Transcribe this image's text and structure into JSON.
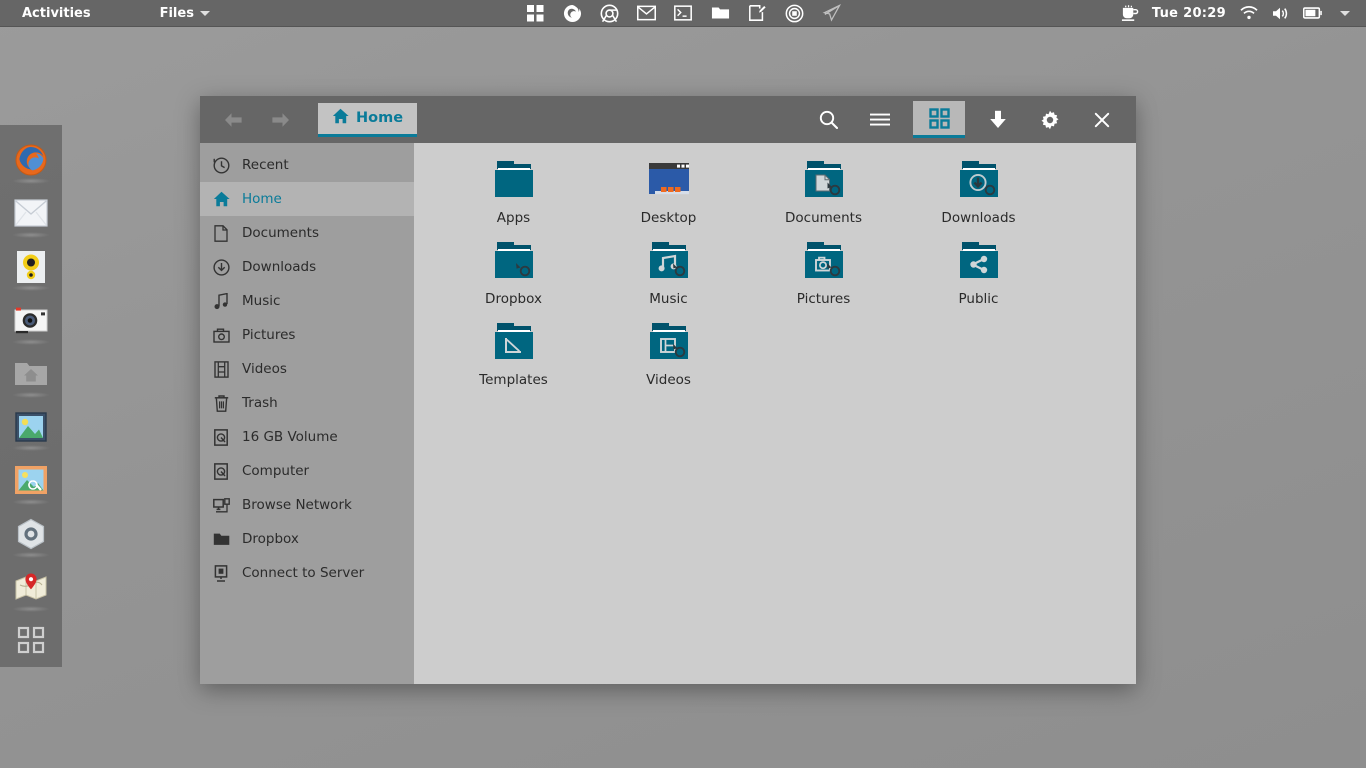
{
  "topbar": {
    "activities": "Activities",
    "app_menu": "Files",
    "app_menu_caret": "chevron-down-icon",
    "center_icons": [
      "apps-grid-icon",
      "firefox-icon",
      "chrome-icon",
      "mail-icon",
      "terminal-icon",
      "files-icon",
      "text-editor-icon",
      "media-disc-icon",
      "sketch-icon"
    ],
    "coffee_icon": "coffee-cup-icon",
    "clock": "Tue 20:29",
    "right_icons": [
      "wifi-icon",
      "volume-icon",
      "battery-icon",
      "chevron-down-icon"
    ]
  },
  "dock": {
    "items": [
      {
        "name": "firefox",
        "label": "Firefox"
      },
      {
        "name": "mail",
        "label": "Mail"
      },
      {
        "name": "media-player",
        "label": "Media Player"
      },
      {
        "name": "camera",
        "label": "Camera"
      },
      {
        "name": "home-folder",
        "label": "Files"
      },
      {
        "name": "image-viewer",
        "label": "Image Viewer"
      },
      {
        "name": "photo-editor",
        "label": "Photo Editor"
      },
      {
        "name": "settings",
        "label": "Settings"
      },
      {
        "name": "maps",
        "label": "Maps"
      },
      {
        "name": "show-applications",
        "label": "Show Applications"
      }
    ]
  },
  "window": {
    "nav": {
      "back": "back-icon",
      "forward": "forward-icon"
    },
    "breadcrumb": {
      "label": "Home",
      "icon": "home-icon"
    },
    "toolbar": [
      {
        "name": "search",
        "icon": "search-icon",
        "active": false
      },
      {
        "name": "list-view",
        "icon": "list-view-icon",
        "active": false
      },
      {
        "name": "grid-view",
        "icon": "grid-view-icon",
        "active": true
      },
      {
        "name": "downloads",
        "icon": "download-arrow-icon",
        "active": false
      },
      {
        "name": "preferences",
        "icon": "gear-icon",
        "active": false
      },
      {
        "name": "close",
        "icon": "close-icon",
        "active": false
      }
    ]
  },
  "sidebar": {
    "items": [
      {
        "label": "Recent",
        "icon": "clock-history-icon",
        "selected": false
      },
      {
        "label": "Home",
        "icon": "home-icon",
        "selected": true
      },
      {
        "label": "Documents",
        "icon": "document-icon",
        "selected": false
      },
      {
        "label": "Downloads",
        "icon": "download-icon",
        "selected": false
      },
      {
        "label": "Music",
        "icon": "music-note-icon",
        "selected": false
      },
      {
        "label": "Pictures",
        "icon": "camera-icon",
        "selected": false
      },
      {
        "label": "Videos",
        "icon": "film-icon",
        "selected": false
      },
      {
        "label": "Trash",
        "icon": "trash-icon",
        "selected": false
      },
      {
        "label": "16 GB Volume",
        "icon": "drive-icon",
        "selected": false
      },
      {
        "label": "Computer",
        "icon": "drive-icon",
        "selected": false
      },
      {
        "label": "Browse Network",
        "icon": "network-icon",
        "selected": false
      },
      {
        "label": "Dropbox",
        "icon": "folder-icon",
        "selected": false
      },
      {
        "label": "Connect to Server",
        "icon": "server-icon",
        "selected": false
      }
    ]
  },
  "files": {
    "items": [
      {
        "label": "Apps",
        "icon": "folder-plain-icon",
        "emblem": "none",
        "badge": false
      },
      {
        "label": "Desktop",
        "icon": "desktop-screen-icon",
        "emblem": "none",
        "badge": false
      },
      {
        "label": "Documents",
        "icon": "folder-icon",
        "emblem": "document",
        "badge": true
      },
      {
        "label": "Downloads",
        "icon": "folder-icon",
        "emblem": "download",
        "badge": true
      },
      {
        "label": "Dropbox",
        "icon": "folder-icon",
        "emblem": "none",
        "badge": true
      },
      {
        "label": "Music",
        "icon": "folder-icon",
        "emblem": "music",
        "badge": true
      },
      {
        "label": "Pictures",
        "icon": "folder-icon",
        "emblem": "camera",
        "badge": true
      },
      {
        "label": "Public",
        "icon": "folder-icon",
        "emblem": "share",
        "badge": false
      },
      {
        "label": "Templates",
        "icon": "folder-icon",
        "emblem": "template",
        "badge": false
      },
      {
        "label": "Videos",
        "icon": "folder-icon",
        "emblem": "video",
        "badge": true
      }
    ]
  },
  "colors": {
    "topbar_bg": "#666666",
    "desktop_bg": "#979797",
    "sidebar_bg": "#9e9e9e",
    "sidebar_selected_bg": "#b3b3b3",
    "content_bg": "#cdcdcd",
    "headerbar_bg": "#666666",
    "accent_teal": "#0a7b99",
    "folder_teal": "#006680",
    "text_dark": "#2a2a2a"
  }
}
